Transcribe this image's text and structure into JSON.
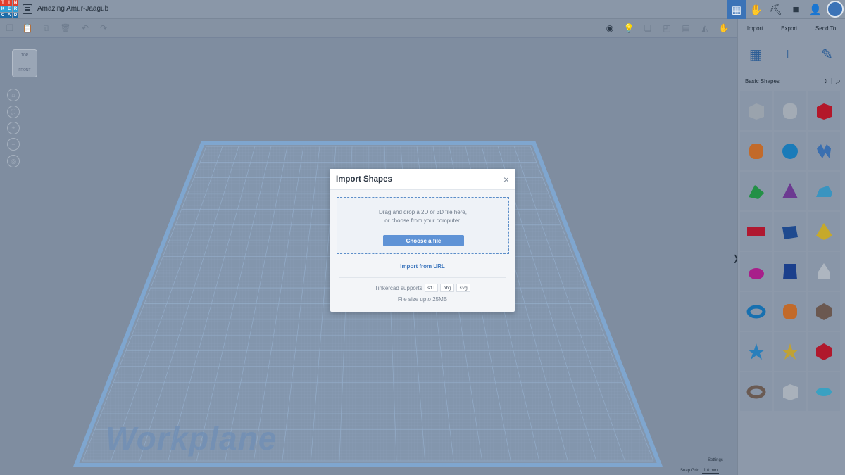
{
  "header": {
    "logo_letters": [
      "T",
      "I",
      "N",
      "K",
      "E",
      "R",
      "C",
      "A",
      "D"
    ],
    "design_title": "Amazing Amur-Jaagub",
    "buttons": [
      {
        "name": "grid-view-button",
        "icon": "grid-icon",
        "glyph": "▦",
        "active": true
      },
      {
        "name": "blocks-button",
        "icon": "hand-icon",
        "glyph": "✋",
        "active": false
      },
      {
        "name": "bricks-button",
        "icon": "pickaxe-icon",
        "glyph": "⛏",
        "active": false
      },
      {
        "name": "lessons-button",
        "icon": "briefcase-icon",
        "glyph": "■",
        "active": false
      },
      {
        "name": "add-user-button",
        "icon": "add-user-icon",
        "glyph": "👤",
        "active": false
      }
    ]
  },
  "right_panel": {
    "tabs": [
      "Import",
      "Export",
      "Send To"
    ],
    "tools": [
      {
        "name": "workplane-tool",
        "icon": "workplane-icon",
        "glyph": "▦"
      },
      {
        "name": "ruler-tool",
        "icon": "ruler-icon",
        "glyph": "∟"
      },
      {
        "name": "notes-tool",
        "icon": "note-icon",
        "glyph": "✎"
      }
    ],
    "shape_category": "Basic Shapes",
    "shapes": [
      {
        "name": "box-hole",
        "color": "#9aa3ad"
      },
      {
        "name": "cylinder-hole",
        "color": "#a3abb5"
      },
      {
        "name": "box",
        "color": "#b3172a"
      },
      {
        "name": "cylinder",
        "color": "#c26a2a"
      },
      {
        "name": "sphere",
        "color": "#1a7bb9"
      },
      {
        "name": "scribble",
        "color": "#3a6fb0"
      },
      {
        "name": "roof",
        "color": "#239046"
      },
      {
        "name": "cone",
        "color": "#6c3a91"
      },
      {
        "name": "round-roof",
        "color": "#3a94c0"
      },
      {
        "name": "text",
        "color": "#b01830"
      },
      {
        "name": "wedge",
        "color": "#1f4a8f"
      },
      {
        "name": "pyramid",
        "color": "#c6a92b"
      },
      {
        "name": "half-sphere",
        "color": "#a81f8a"
      },
      {
        "name": "polygon",
        "color": "#1b3f8c"
      },
      {
        "name": "paraboloid",
        "color": "#aeb6c0"
      },
      {
        "name": "torus",
        "color": "#1770b0"
      },
      {
        "name": "tube",
        "color": "#c26a2a"
      },
      {
        "name": "icosahedron",
        "color": "#6b5850"
      },
      {
        "name": "star",
        "color": "#2a7fbb"
      },
      {
        "name": "star-gold",
        "color": "#c0a235"
      },
      {
        "name": "polyhedron",
        "color": "#b0182c"
      },
      {
        "name": "ring",
        "color": "#6a5a52"
      },
      {
        "name": "round-box",
        "color": "#a9b1bb"
      },
      {
        "name": "ellipsoid",
        "color": "#3aa1c2"
      }
    ]
  },
  "workspace": {
    "viewcube_top": "TOP",
    "viewcube_front": "FRONT",
    "workplane_label": "Workplane",
    "settings_label": "Settings",
    "snap_grid_label": "Snap Grid",
    "snap_grid_value": "1.0 mm"
  },
  "modal": {
    "title": "Import Shapes",
    "close_glyph": "×",
    "dropzone_line1": "Drag and drop a 2D or 3D file here,",
    "dropzone_line2": "or choose from your computer.",
    "choose_button": "Choose a file",
    "import_url": "Import from URL",
    "supports_label": "Tinkercad supports",
    "formats": [
      "stl",
      "obj",
      "svg"
    ],
    "file_size": "File size upto 25MB"
  }
}
